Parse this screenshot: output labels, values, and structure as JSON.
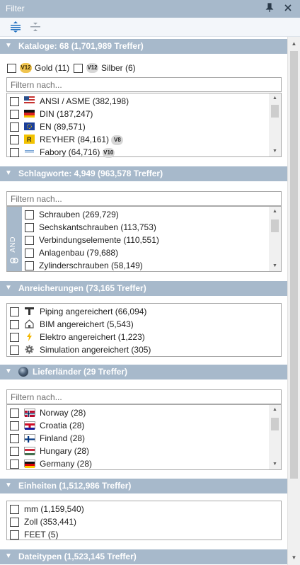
{
  "window": {
    "title": "Filter"
  },
  "toolbar": {
    "expand_all_icon": "expand-all-icon",
    "collapse_all_icon": "collapse-all-icon"
  },
  "kataloge": {
    "header": "Kataloge: 68 (1,701,989 Treffer)",
    "gold": {
      "badge": "V12",
      "label": "Gold (11)"
    },
    "silver": {
      "badge": "V12",
      "label": "Silber (6)"
    },
    "filter_placeholder": "Filtern nach...",
    "items": [
      {
        "label": "ANSI / ASME (382,198)",
        "icon": "ansi-flag-icon"
      },
      {
        "label": "DIN (187,247)",
        "icon": "din-flag-icon"
      },
      {
        "label": "EN (89,571)",
        "icon": "en-flag-icon"
      },
      {
        "label": "REYHER (84,161)",
        "icon": "reyher-logo-icon",
        "badge": "V8"
      },
      {
        "label": "Fabory (64,716)",
        "icon": "fabory-logo-icon",
        "badge": "V10"
      }
    ]
  },
  "schlagworte": {
    "header": "Schlagworte: 4,949 (963,578 Treffer)",
    "filter_placeholder": "Filtern nach...",
    "and_label": "AND",
    "items": [
      {
        "label": "Schrauben (269,729)"
      },
      {
        "label": "Sechskantschrauben (113,753)"
      },
      {
        "label": "Verbindungselemente (110,551)"
      },
      {
        "label": "Anlagenbau (79,688)"
      },
      {
        "label": "Zylinderschrauben (58,149)"
      }
    ]
  },
  "anreicherungen": {
    "header": "Anreicherungen (73,165 Treffer)",
    "items": [
      {
        "label": "Piping angereichert (66,094)",
        "icon": "piping-icon"
      },
      {
        "label": "BIM angereichert (5,543)",
        "icon": "bim-house-icon"
      },
      {
        "label": "Elektro angereichert (1,223)",
        "icon": "lightning-icon"
      },
      {
        "label": "Simulation angereichert (305)",
        "icon": "gear-icon"
      }
    ]
  },
  "lieferlaender": {
    "header": "Lieferländer (29 Treffer)",
    "filter_placeholder": "Filtern nach...",
    "items": [
      {
        "label": "Norway (28)",
        "icon": "norway-flag-icon"
      },
      {
        "label": "Croatia (28)",
        "icon": "croatia-flag-icon"
      },
      {
        "label": "Finland (28)",
        "icon": "finland-flag-icon"
      },
      {
        "label": "Hungary (28)",
        "icon": "hungary-flag-icon"
      },
      {
        "label": "Germany (28)",
        "icon": "germany-flag-icon"
      }
    ]
  },
  "einheiten": {
    "header": "Einheiten (1,512,986 Treffer)",
    "items": [
      {
        "label": "mm (1,159,540)"
      },
      {
        "label": "Zoll (353,441)"
      },
      {
        "label": "FEET (5)"
      }
    ]
  },
  "dateitypen": {
    "header": "Dateitypen (1,523,145 Treffer)"
  },
  "colors": {
    "header_bg": "#a7b9cb",
    "accent_blue": "#1e6fc0",
    "gold": "#f0c44f"
  }
}
